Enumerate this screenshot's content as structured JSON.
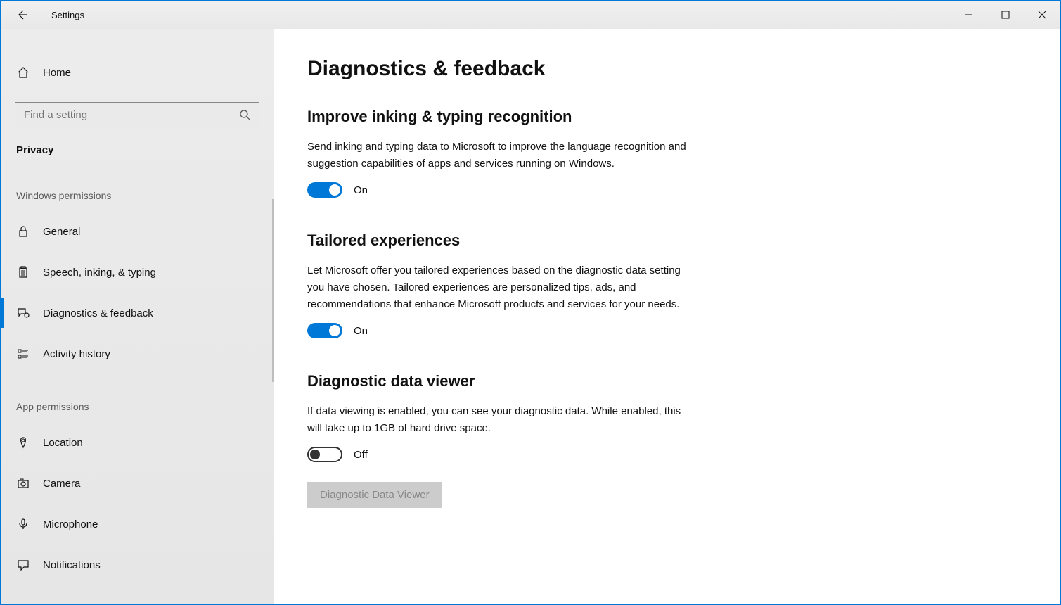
{
  "window": {
    "title": "Settings"
  },
  "sidebar": {
    "home": "Home",
    "search_placeholder": "Find a setting",
    "category": "Privacy",
    "groups": [
      {
        "label": "Windows permissions",
        "items": [
          {
            "icon": "lock-icon",
            "label": "General"
          },
          {
            "icon": "clipboard-icon",
            "label": "Speech, inking, & typing"
          },
          {
            "icon": "feedback-icon",
            "label": "Diagnostics & feedback",
            "active": true
          },
          {
            "icon": "history-icon",
            "label": "Activity history"
          }
        ]
      },
      {
        "label": "App permissions",
        "items": [
          {
            "icon": "location-icon",
            "label": "Location"
          },
          {
            "icon": "camera-icon",
            "label": "Camera"
          },
          {
            "icon": "microphone-icon",
            "label": "Microphone"
          },
          {
            "icon": "notification-icon",
            "label": "Notifications"
          }
        ]
      }
    ]
  },
  "main": {
    "title": "Diagnostics & feedback",
    "sections": [
      {
        "heading": "Improve inking & typing recognition",
        "desc": "Send inking and typing data to Microsoft to improve the language recognition and suggestion capabilities of apps and services running on Windows.",
        "toggle": {
          "state": "on",
          "label": "On"
        }
      },
      {
        "heading": "Tailored experiences",
        "desc": "Let Microsoft offer you tailored experiences based on the diagnostic data setting you have chosen. Tailored experiences are personalized tips, ads, and recommendations that enhance Microsoft products and services for your needs.",
        "toggle": {
          "state": "on",
          "label": "On"
        }
      },
      {
        "heading": "Diagnostic data viewer",
        "desc": "If data viewing is enabled, you can see your diagnostic data. While enabled, this will take up to 1GB of hard drive space.",
        "toggle": {
          "state": "off",
          "label": "Off"
        },
        "button": "Diagnostic Data Viewer"
      }
    ]
  }
}
